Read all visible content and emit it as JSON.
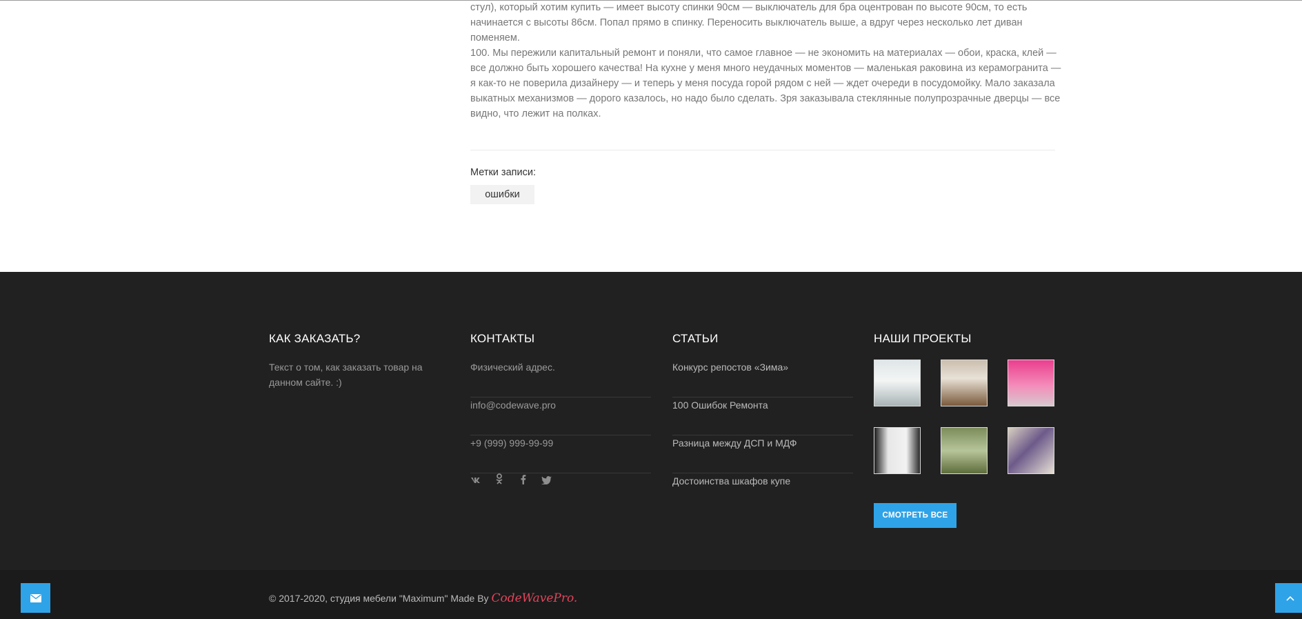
{
  "article": {
    "lines": [
      "стул), который хотим купить — имеет высоту спинки 90см — выключатель для бра оцентрован по высоте 90см, то есть",
      "начинается с высоты 86см. Попал прямо в спинку. Переносить выключатель выше, а вдруг через несколько лет диван",
      "поменяем.",
      "100. Мы пережили капитальный ремонт и поняли, что самое главное — не экономить на материалах — обои, краска, клей —",
      "все должно быть хорошего качества! На кухне у меня много неудачных моментов — маленькая раковина из керамогранита —",
      "я как-то не поверила дизайнеру — и теперь у меня посуда горой рядом с ней — ждет очереди в посудомойку. Мало заказала",
      "выкатных механизмов — дорого казалось, но надо было сделать. Зря заказывала стеклянные полупрозрачные дверцы — все",
      "видно, что лежит на полках."
    ]
  },
  "tags": {
    "title": "Метки записи:",
    "items": [
      "ошибки"
    ]
  },
  "footer": {
    "order": {
      "title": "КАК ЗАКАЗАТЬ?",
      "text": "Текст о том, как заказать товар на данном сайте. :)"
    },
    "contacts": {
      "title": "КОНТАКТЫ",
      "items": [
        "Физический адрес.",
        "info@codewave.pro",
        "+9 (999) 999-99-99"
      ],
      "social": [
        "vk-icon",
        "odnoklassniki-icon",
        "facebook-icon",
        "twitter-icon"
      ]
    },
    "articles": {
      "title": "СТАТЬИ",
      "items": [
        "Конкурс репостов «Зима»",
        "100 Ошибок Ремонта",
        "Разница между ДСП и МДФ",
        "Достоинства шкафов купе"
      ]
    },
    "projects": {
      "title": "НАШИ ПРОЕКТЫ",
      "button": "СМОТРЕТЬ ВСЕ"
    }
  },
  "copyright": {
    "text": "© 2017-2020, студия мебели \"Maximum\" Made By ",
    "brand": "CodeWavePro."
  },
  "colors": {
    "accent": "#2fa3e8",
    "footer_bg": "#212121",
    "brand": "#e2455a"
  }
}
